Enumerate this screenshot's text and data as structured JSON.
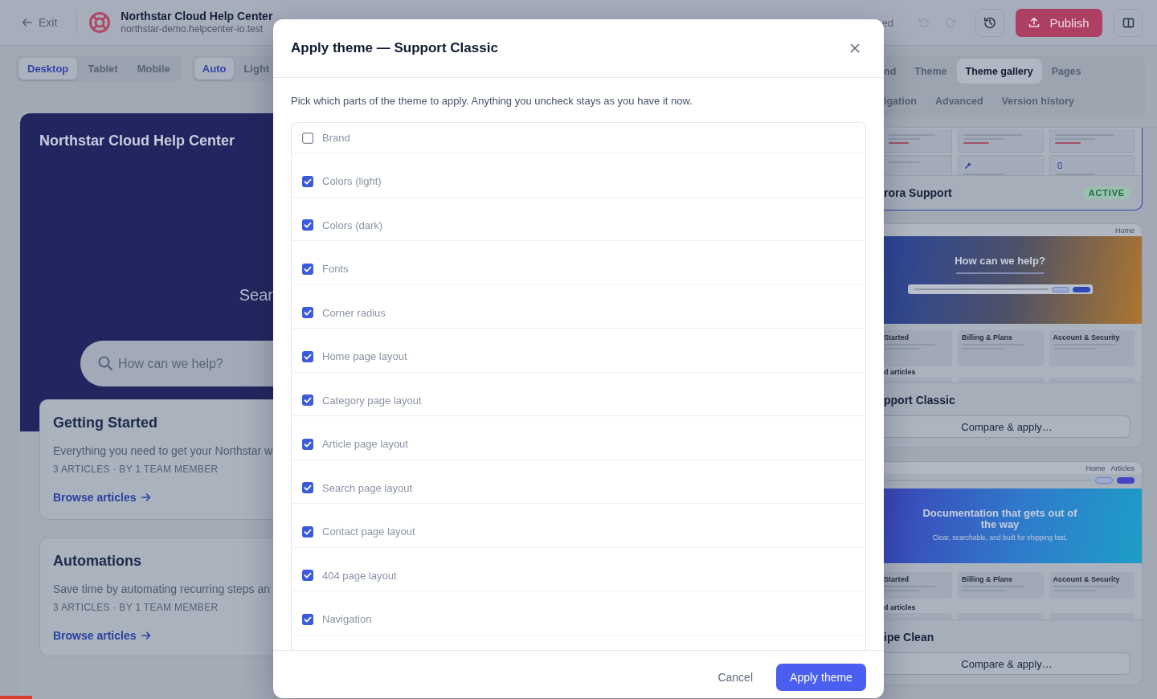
{
  "top_bar": {
    "exit": "Exit",
    "site_title": "Northstar Cloud Help Center",
    "site_url": "northstar-demo.helpcenter-io.test",
    "save_status": "ed",
    "undo": {
      "disabled": true
    },
    "redo": {
      "disabled": true
    },
    "publish": "Publish"
  },
  "device_switch": [
    {
      "label": "Desktop",
      "selected": true
    },
    {
      "label": "Tablet",
      "selected": false
    },
    {
      "label": "Mobile",
      "selected": false
    }
  ],
  "color_mode_switch": [
    {
      "label": "Auto",
      "selected": true
    },
    {
      "label": "Light",
      "selected": false
    }
  ],
  "preview": {
    "site_title": "Northstar Cloud Help Center",
    "heading": "Sear",
    "search": {
      "placeholder": "How can we help?"
    },
    "categories": [
      {
        "title": "Getting Started",
        "description": "Everything you need to get your Northstar w",
        "meta": "3 ARTICLES · BY 1 TEAM MEMBER",
        "link": "Browse articles"
      },
      {
        "title": "Automations",
        "description": "Save time by automating recurring steps an",
        "meta": "3 ARTICLES · BY 1 TEAM MEMBER",
        "link": "Browse articles"
      }
    ]
  },
  "side_panel": {
    "tab_rows": [
      {
        "tabs": [
          {
            "label": "nd",
            "selected": false
          },
          {
            "label": "Theme",
            "selected": false
          },
          {
            "label": "Theme gallery",
            "selected": true
          },
          {
            "label": "Pages",
            "selected": false
          }
        ]
      },
      {
        "tabs": [
          {
            "label": "igation",
            "selected": false
          },
          {
            "label": "Advanced",
            "selected": false
          },
          {
            "label": "Version history",
            "selected": false
          }
        ]
      }
    ],
    "themes": [
      {
        "name": "rora Support",
        "active": true,
        "badge": "ACTIVE",
        "preview": {
          "kind": "grid"
        }
      },
      {
        "name": "pport Classic",
        "active": false,
        "action": "Compare & apply…",
        "preview": {
          "kind": "search",
          "nav": [
            "Home"
          ],
          "headline": "How can we help?",
          "categories": [
            "Started",
            "Billing & Plans",
            "Account & Security"
          ],
          "section": "d articles"
        }
      },
      {
        "name": "ipe Clean",
        "active": false,
        "action": "Compare & apply…",
        "preview": {
          "kind": "docs",
          "nav": [
            "Home",
            "Articles"
          ],
          "headline": "Documentation that gets out of the way",
          "subtitle": "Clear, searchable, and built for shipping fast.",
          "categories": [
            "Started",
            "Billing & Plans",
            "Account & Security"
          ],
          "section": "d articles"
        }
      }
    ]
  },
  "dialog": {
    "title": "Apply theme — Support Classic",
    "description": "Pick which parts of the theme to apply. Anything you uncheck stays as you have it now.",
    "parts": [
      {
        "label": "Brand",
        "checked": false
      },
      {
        "label": "Colors (light)",
        "checked": true
      },
      {
        "label": "Colors (dark)",
        "checked": true
      },
      {
        "label": "Fonts",
        "checked": true
      },
      {
        "label": "Corner radius",
        "checked": true
      },
      {
        "label": "Home page layout",
        "checked": true
      },
      {
        "label": "Category page layout",
        "checked": true
      },
      {
        "label": "Article page layout",
        "checked": true
      },
      {
        "label": "Search page layout",
        "checked": true
      },
      {
        "label": "Contact page layout",
        "checked": true
      },
      {
        "label": "404 page layout",
        "checked": true
      },
      {
        "label": "Navigation",
        "checked": true
      }
    ],
    "cancel": "Cancel",
    "confirm": "Apply theme"
  }
}
